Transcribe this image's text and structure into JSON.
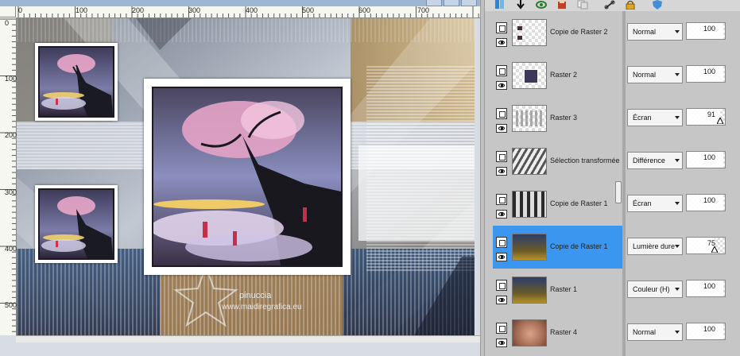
{
  "canvas_window": {
    "title": "",
    "ruler": {
      "h_labels": [
        "0",
        "100",
        "200",
        "300",
        "400",
        "500",
        "600",
        "700"
      ],
      "v_labels": [
        "0",
        "100",
        "200",
        "300",
        "400",
        "500"
      ]
    },
    "watermark": {
      "line1": "pinuccia",
      "line2": "www.maidiregrafica.eu"
    }
  },
  "toolbar": {
    "icons": [
      "new-layer-icon",
      "arrow-down-icon",
      "visibility-icon",
      "paint-icon",
      "copy-icon",
      "link-icon",
      "lock-icon",
      "shield-icon"
    ]
  },
  "layers": [
    {
      "name": "Copie de Raster 2",
      "blend": "Normal",
      "opacity": 100,
      "selected": false,
      "thumb": "transparent-bits"
    },
    {
      "name": "Raster 2",
      "blend": "Normal",
      "opacity": 100,
      "selected": false,
      "thumb": "small-image"
    },
    {
      "name": "Raster 3",
      "blend": "Écran",
      "opacity": 91,
      "selected": false,
      "thumb": "grey-dots"
    },
    {
      "name": "Sélection transformée",
      "blend": "Différence",
      "opacity": 100,
      "selected": false,
      "thumb": "grey-stripes"
    },
    {
      "name": "Copie de Raster 1",
      "blend": "Écran",
      "opacity": 100,
      "selected": false,
      "thumb": "dark-stripes"
    },
    {
      "name": "Copie de Raster 1",
      "blend": "Lumière dure",
      "opacity": 75,
      "selected": true,
      "thumb": "blue-gold"
    },
    {
      "name": "Raster 1",
      "blend": "Couleur (H)",
      "opacity": 100,
      "selected": false,
      "thumb": "blue-gold"
    },
    {
      "name": "Raster 4",
      "blend": "Normal",
      "opacity": 100,
      "selected": false,
      "thumb": "peach"
    }
  ],
  "colors": {
    "selected_row": "#3b96f0",
    "palette_bg": "#c6c6c6"
  }
}
